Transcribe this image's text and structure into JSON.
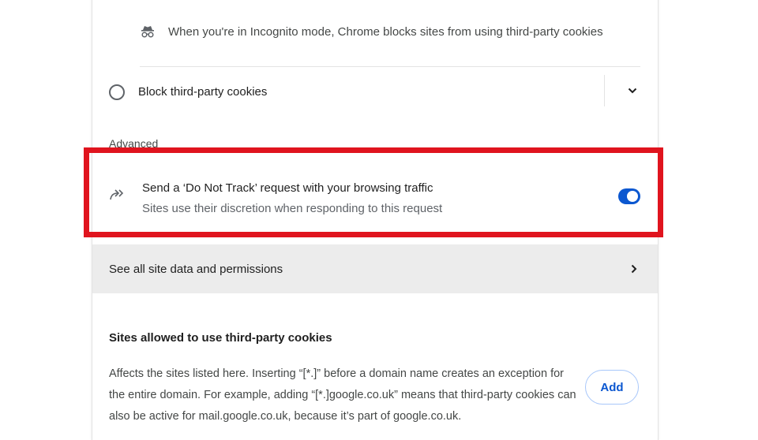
{
  "incognito": {
    "icon": "incognito-icon",
    "text": "When you're in Incognito mode, Chrome blocks sites from using third-party cookies"
  },
  "block_option": {
    "label": "Block third-party cookies",
    "selected": false,
    "expand_icon": "chevron-down-icon"
  },
  "advanced": {
    "heading": "Advanced"
  },
  "do_not_track": {
    "icon": "do-not-track-icon",
    "title": "Send a ‘Do Not Track’ request with your browsing traffic",
    "subtitle": "Sites use their discretion when responding to this request",
    "enabled": true
  },
  "site_data": {
    "label": "See all site data and permissions",
    "icon": "chevron-right-icon"
  },
  "allowed_sites": {
    "heading": "Sites allowed to use third-party cookies",
    "description": "Affects the sites listed here. Inserting “[*.]” before a domain name creates an exception for the entire domain. For example, adding “[*.]google.co.uk” means that third-party cookies can also be active for mail.google.co.uk, because it’s part of google.co.uk.",
    "add_label": "Add"
  },
  "colors": {
    "accent": "#0b57d0",
    "highlight": "#e0141e",
    "row_hover": "#ececec"
  }
}
